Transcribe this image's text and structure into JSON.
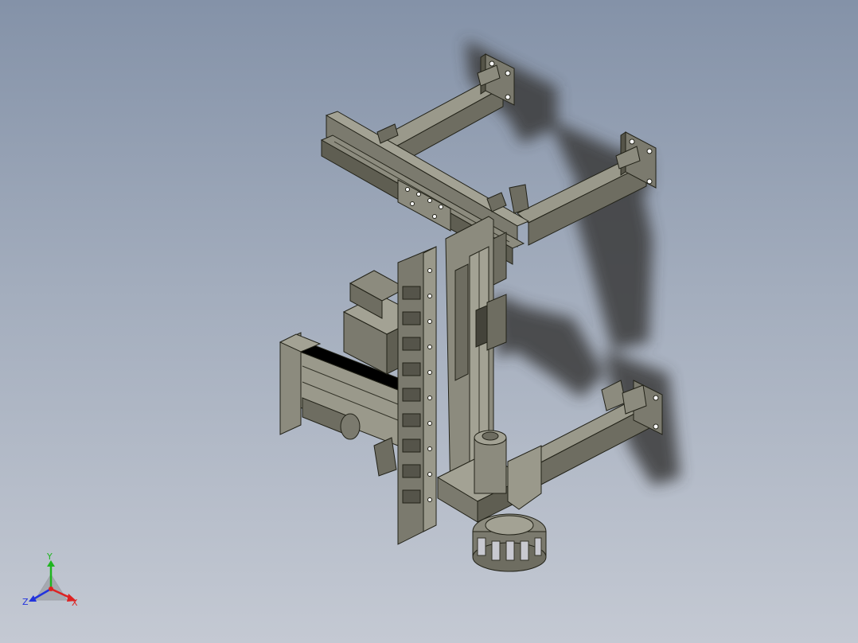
{
  "viewport": {
    "background_top": "#8492a8",
    "background_bottom": "#c4c9d3",
    "model_colors": {
      "steel": "#7b7a6e",
      "steel_light": "#9a998b",
      "steel_dark": "#555448",
      "outline": "#222218",
      "shadow": "#3a3a3a"
    }
  },
  "triad": {
    "y_label": "Y",
    "z_label": "Z",
    "x_label": "X",
    "y_color": "#1fb51f",
    "z_color": "#2233dd",
    "x_color": "#dd2222"
  }
}
